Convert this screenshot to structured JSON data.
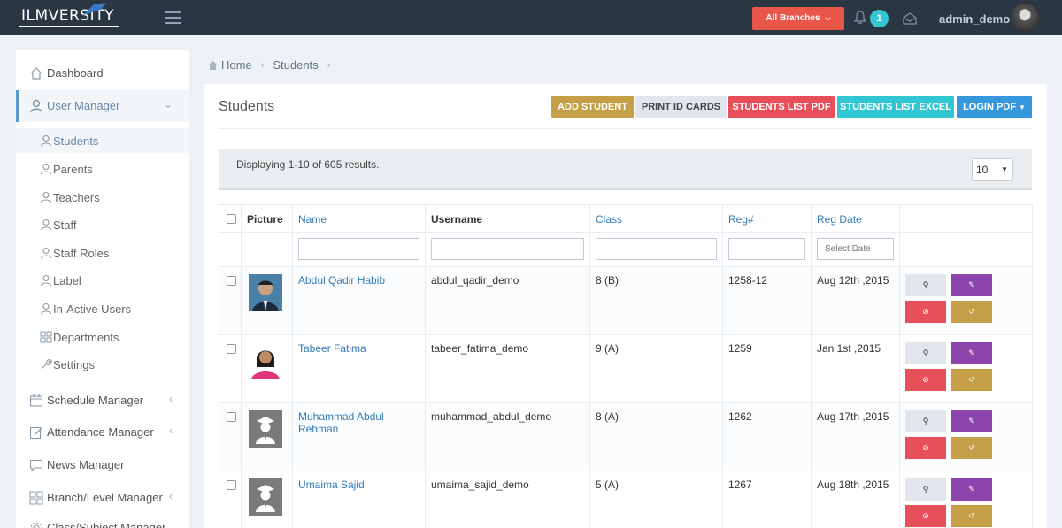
{
  "brand": {
    "logo_text": "ILMVERSITY"
  },
  "header": {
    "branches_label": "All Branches",
    "notification_count": "1",
    "username": "admin_demo"
  },
  "sidebar": {
    "items": [
      {
        "label": "Dashboard",
        "icon": "home-icon"
      },
      {
        "label": "User Manager",
        "icon": "user-icon"
      },
      {
        "label": "Schedule Manager",
        "icon": "calendar-icon"
      },
      {
        "label": "Attendance Manager",
        "icon": "edit-icon"
      },
      {
        "label": "News Manager",
        "icon": "chat-icon"
      },
      {
        "label": "Branch/Level Manager",
        "icon": "grid-icon"
      },
      {
        "label": "Class/Subject Manager",
        "icon": "gear-icon"
      }
    ],
    "sub_items": [
      {
        "label": "Students"
      },
      {
        "label": "Parents"
      },
      {
        "label": "Teachers"
      },
      {
        "label": "Staff"
      },
      {
        "label": "Staff Roles"
      },
      {
        "label": "Label"
      },
      {
        "label": "In-Active Users"
      },
      {
        "label": "Departments"
      },
      {
        "label": "Settings"
      }
    ]
  },
  "breadcrumb": {
    "home": "Home",
    "current": "Students"
  },
  "panel": {
    "title": "Students",
    "buttons": {
      "add": "ADD STUDENT",
      "print": "PRINT ID CARDS",
      "pdf": "STUDENTS LIST PDF",
      "excel": "STUDENTS LIST EXCEL",
      "login": "LOGIN PDF"
    },
    "info": "Displaying 1-10 of 605 results.",
    "page_size": "10"
  },
  "table": {
    "headers": [
      "Picture",
      "Name",
      "Username",
      "Class",
      "Reg#",
      "Reg Date"
    ],
    "date_placeholder": "Select Date",
    "rows": [
      {
        "name": "Abdul Qadir Habib",
        "username": "abdul_qadir_demo",
        "class": "8 (B)",
        "reg": "1258-12",
        "date": "Aug 12th ,2015"
      },
      {
        "name": "Tabeer Fatima",
        "username": "tabeer_fatima_demo",
        "class": "9 (A)",
        "reg": "1259",
        "date": "Jan 1st ,2015"
      },
      {
        "name": "Muhammad Abdul Rehman",
        "username": "muhammad_abdul_demo",
        "class": "8 (A)",
        "reg": "1262",
        "date": "Aug 17th ,2015"
      },
      {
        "name": "Umaima Sajid",
        "username": "umaima_sajid_demo",
        "class": "5 (A)",
        "reg": "1267",
        "date": "Aug 18th ,2015"
      }
    ]
  }
}
